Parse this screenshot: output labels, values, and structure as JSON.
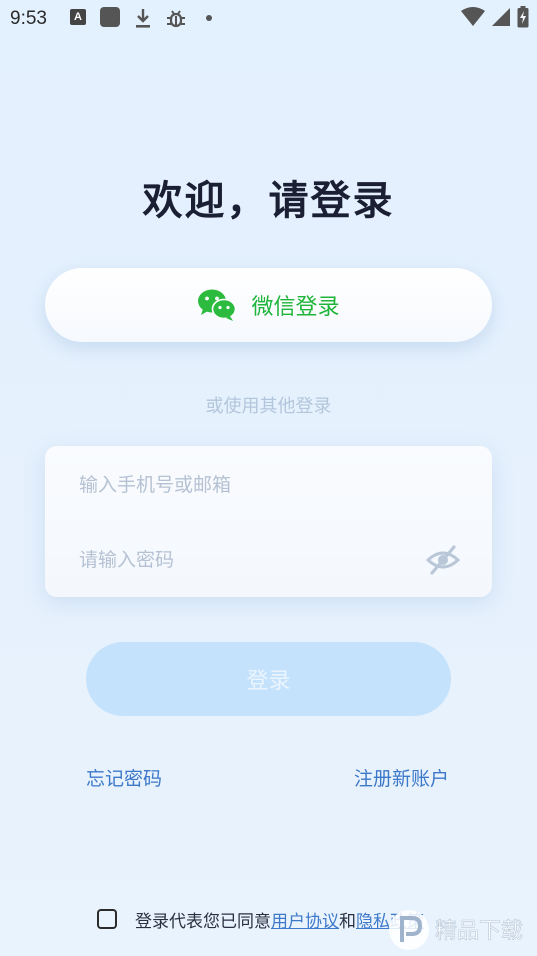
{
  "status_bar": {
    "time": "9:53",
    "left_icons": [
      "font-a-icon",
      "app-square-icon",
      "download-icon",
      "bug-icon",
      "dot-icon"
    ],
    "right_icons": [
      "wifi-icon",
      "signal-icon",
      "battery-charging-icon"
    ]
  },
  "title": "欢迎，请登录",
  "wechat_login": {
    "icon": "wechat-icon",
    "label": "微信登录",
    "color": "#1fb43a"
  },
  "other_login_text": "或使用其他登录",
  "form": {
    "account_placeholder": "输入手机号或邮箱",
    "account_value": "",
    "password_placeholder": "请输入密码",
    "password_value": "",
    "eye_icon": "eye-off-icon"
  },
  "login_button": {
    "label": "登录",
    "color": "#c5e2fc"
  },
  "links": {
    "forgot_password": "忘记密码",
    "register": "注册新账户"
  },
  "agreement": {
    "prefix": "登录代表您已同意",
    "user_agreement": "用户协议",
    "and": "和",
    "privacy_policy": "隐私政策",
    "checked": false
  },
  "accent_color": "#3d78c9",
  "watermark": {
    "icon": "p-logo-icon",
    "text": "精品下载"
  }
}
